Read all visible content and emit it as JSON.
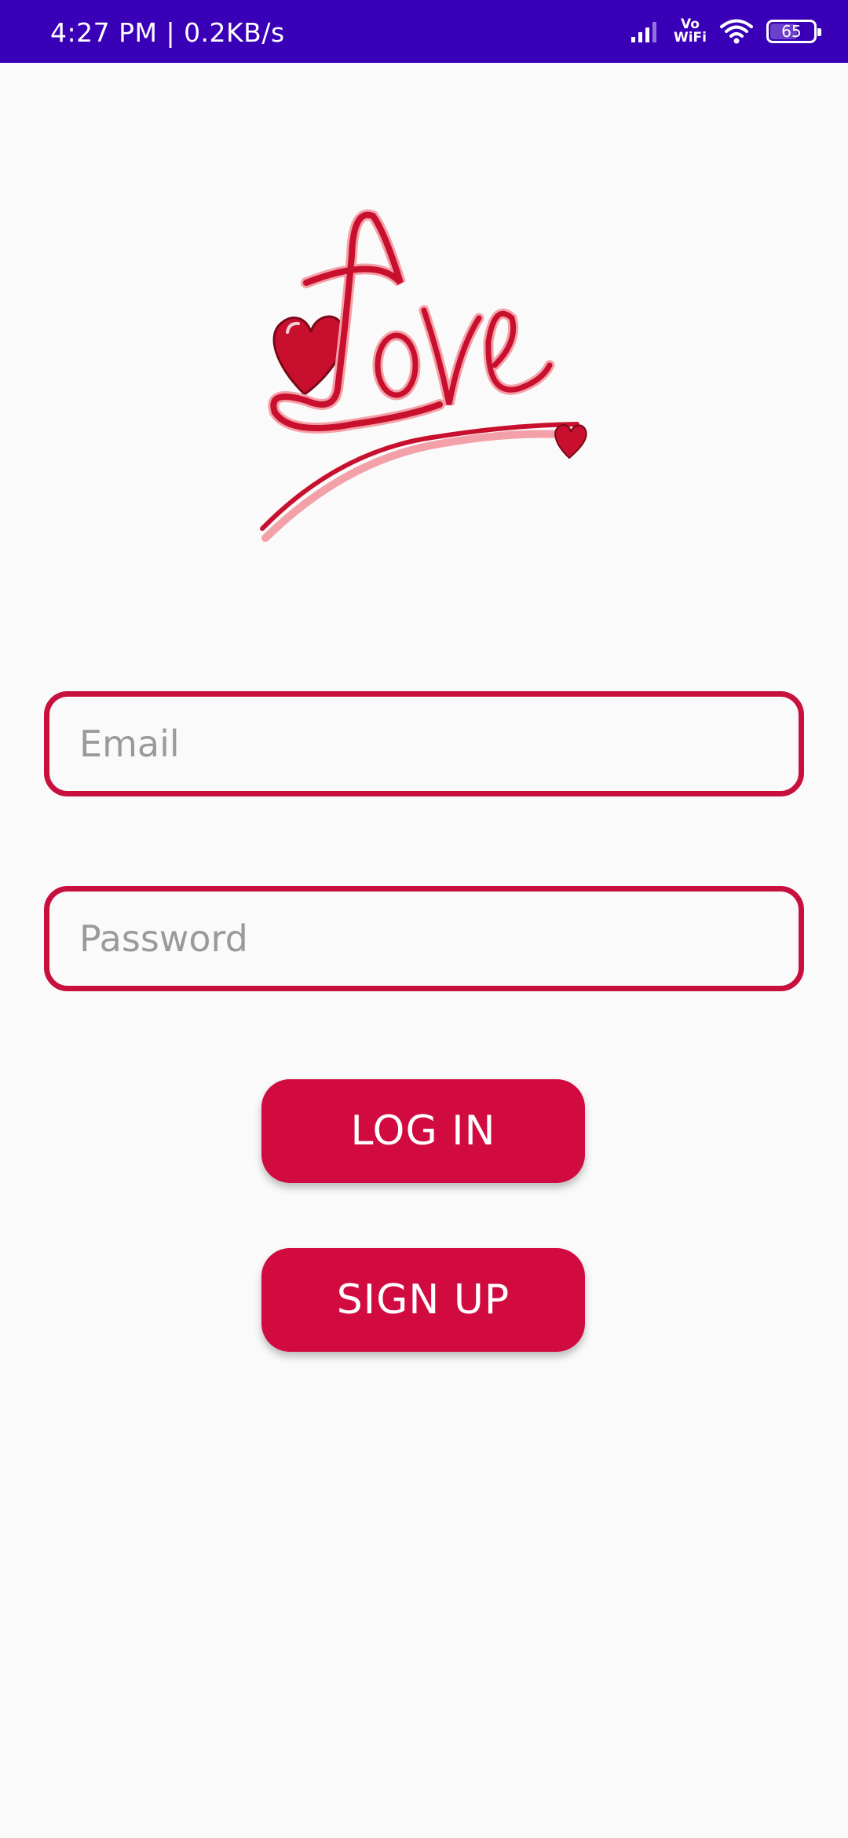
{
  "status_bar": {
    "time_speed": "4:27 PM | 0.2KB/s",
    "vowifi_line1": "Vo",
    "vowifi_line2": "WiFi",
    "battery": "65",
    "battery_level": 0.65,
    "background": "#3a00b8"
  },
  "logo": {
    "icon": "love-heart-logo",
    "colors": {
      "red": "#c8102e",
      "pink": "#f4a0a8"
    }
  },
  "form": {
    "email_placeholder": "Email",
    "email_value": "",
    "password_placeholder": "Password",
    "password_value": "",
    "border_color": "#c8103f"
  },
  "buttons": {
    "login_label": "LOG IN",
    "signup_label": "SIGN UP",
    "color": "#d10a40"
  }
}
